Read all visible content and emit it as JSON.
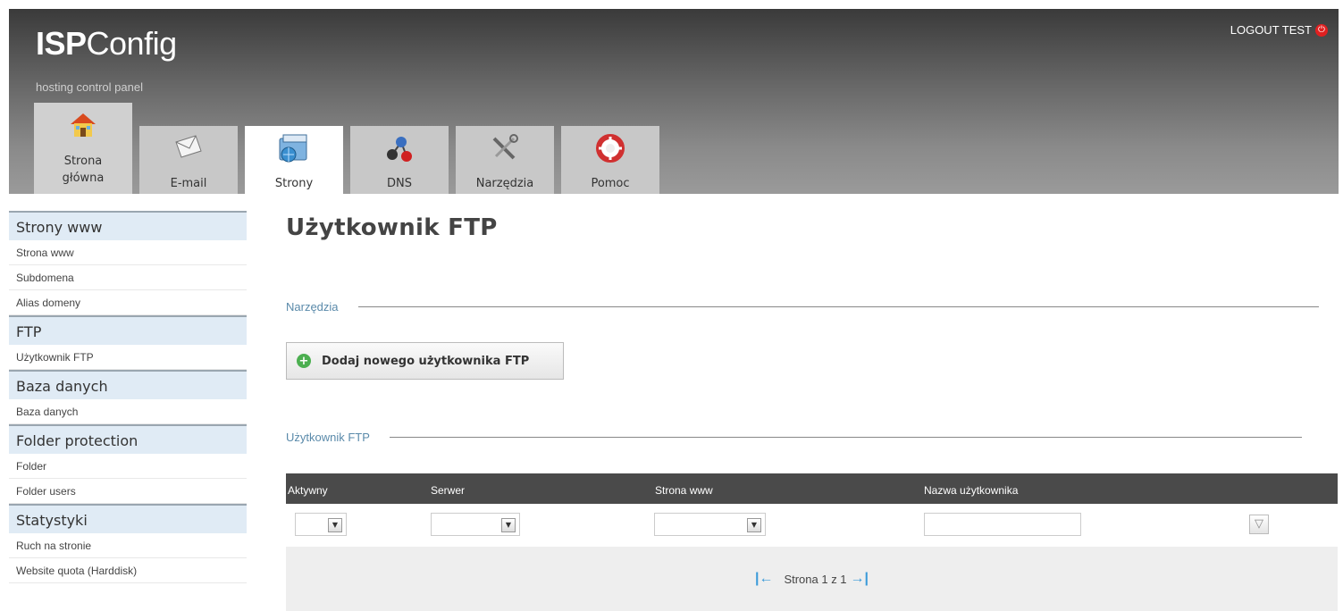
{
  "header": {
    "logo_bold": "ISP",
    "logo_rest": "Config",
    "tagline": "hosting control panel",
    "logout": "LOGOUT TEST"
  },
  "tabs": [
    {
      "label_line1": "Strona",
      "label_line2": "główna",
      "icon": "home-icon"
    },
    {
      "label": "E-mail",
      "icon": "envelope-icon"
    },
    {
      "label": "Strony",
      "icon": "folder-globe-icon",
      "active": true
    },
    {
      "label": "DNS",
      "icon": "network-nodes-icon"
    },
    {
      "label": "Narzędzia",
      "icon": "tools-icon"
    },
    {
      "label": "Pomoc",
      "icon": "lifebuoy-icon"
    }
  ],
  "sidebar": {
    "sections": [
      {
        "title": "Strony www",
        "items": [
          "Strona www",
          "Subdomena",
          "Alias domeny"
        ]
      },
      {
        "title": "FTP",
        "items": [
          "Użytkownik FTP"
        ]
      },
      {
        "title": "Baza danych",
        "items": [
          "Baza danych"
        ]
      },
      {
        "title": "Folder protection",
        "items": [
          "Folder",
          "Folder users"
        ]
      },
      {
        "title": "Statystyki",
        "items": [
          "Ruch na stronie",
          "Website quota (Harddisk)"
        ]
      }
    ]
  },
  "main": {
    "title": "Użytkownik FTP",
    "tools_legend": "Narzędzia",
    "add_button": "Dodaj nowego użytkownika FTP",
    "list_legend": "Użytkownik FTP",
    "columns": [
      "Aktywny",
      "Serwer",
      "Strona www",
      "Nazwa użytkownika"
    ],
    "pager_text": "Strona 1 z 1"
  },
  "colors": {
    "accent_link": "#5a8aaa",
    "sidebar_header_bg": "#e0ebf5",
    "table_header_bg": "#4a4a4a"
  }
}
